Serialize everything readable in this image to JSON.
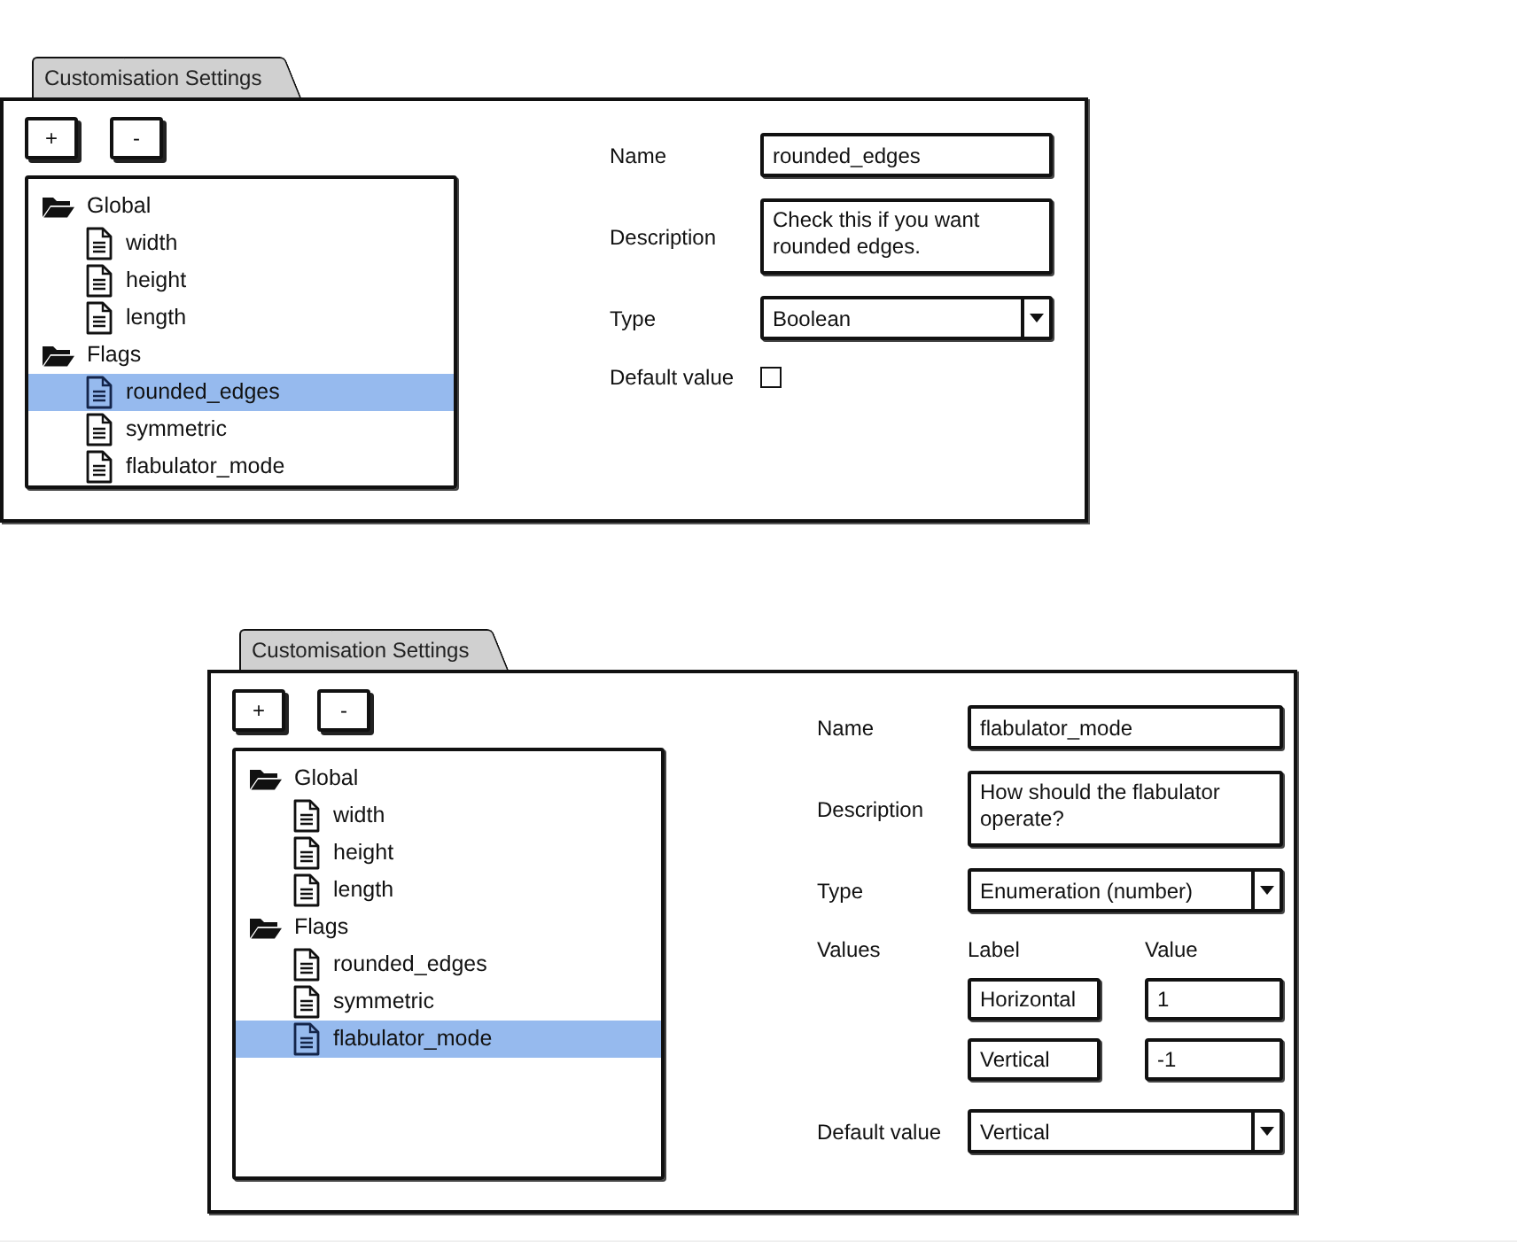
{
  "panels": [
    {
      "tab": "Customisation Settings",
      "buttons": [
        "+",
        "-"
      ],
      "tree": [
        {
          "label": "Global",
          "kind": "folder",
          "expanded": true,
          "selected": false,
          "children": [
            {
              "label": "width",
              "kind": "file",
              "selected": false
            },
            {
              "label": "height",
              "kind": "file",
              "selected": false
            },
            {
              "label": "length",
              "kind": "file",
              "selected": false
            }
          ]
        },
        {
          "label": "Flags",
          "kind": "folder",
          "expanded": true,
          "selected": false,
          "children": [
            {
              "label": "rounded_edges",
              "kind": "file",
              "selected": true
            },
            {
              "label": "symmetric",
              "kind": "file",
              "selected": false
            },
            {
              "label": "flabulator_mode",
              "kind": "file",
              "selected": false
            }
          ]
        }
      ],
      "fields": [
        {
          "kind": "text",
          "label": "Name",
          "value": "rounded_edges"
        },
        {
          "kind": "textarea",
          "label": "Description",
          "value": "Check this if you want rounded edges."
        },
        {
          "kind": "select",
          "label": "Type",
          "value": "Boolean"
        },
        {
          "kind": "checkbox",
          "label": "Default value",
          "checked": false
        }
      ]
    },
    {
      "tab": "Customisation Settings",
      "buttons": [
        "+",
        "-"
      ],
      "tree": [
        {
          "label": "Global",
          "kind": "folder",
          "expanded": true,
          "selected": false,
          "children": [
            {
              "label": "width",
              "kind": "file",
              "selected": false
            },
            {
              "label": "height",
              "kind": "file",
              "selected": false
            },
            {
              "label": "length",
              "kind": "file",
              "selected": false
            }
          ]
        },
        {
          "label": "Flags",
          "kind": "folder",
          "expanded": true,
          "selected": false,
          "children": [
            {
              "label": "rounded_edges",
              "kind": "file",
              "selected": false
            },
            {
              "label": "symmetric",
              "kind": "file",
              "selected": false
            },
            {
              "label": "flabulator_mode",
              "kind": "file",
              "selected": true
            }
          ]
        }
      ],
      "fields": [
        {
          "kind": "text",
          "label": "Name",
          "value": "flabulator_mode"
        },
        {
          "kind": "textarea",
          "label": "Description",
          "value": "How should the flabulator operate?"
        },
        {
          "kind": "select",
          "label": "Type",
          "value": "Enumeration (number)"
        },
        {
          "kind": "table",
          "label": "Values",
          "columns": [
            "Label",
            "Value"
          ],
          "rows": [
            [
              "Horizontal",
              "1"
            ],
            [
              "Vertical",
              "-1"
            ]
          ]
        },
        {
          "kind": "select",
          "label": "Default value",
          "value": "Vertical"
        }
      ]
    }
  ]
}
